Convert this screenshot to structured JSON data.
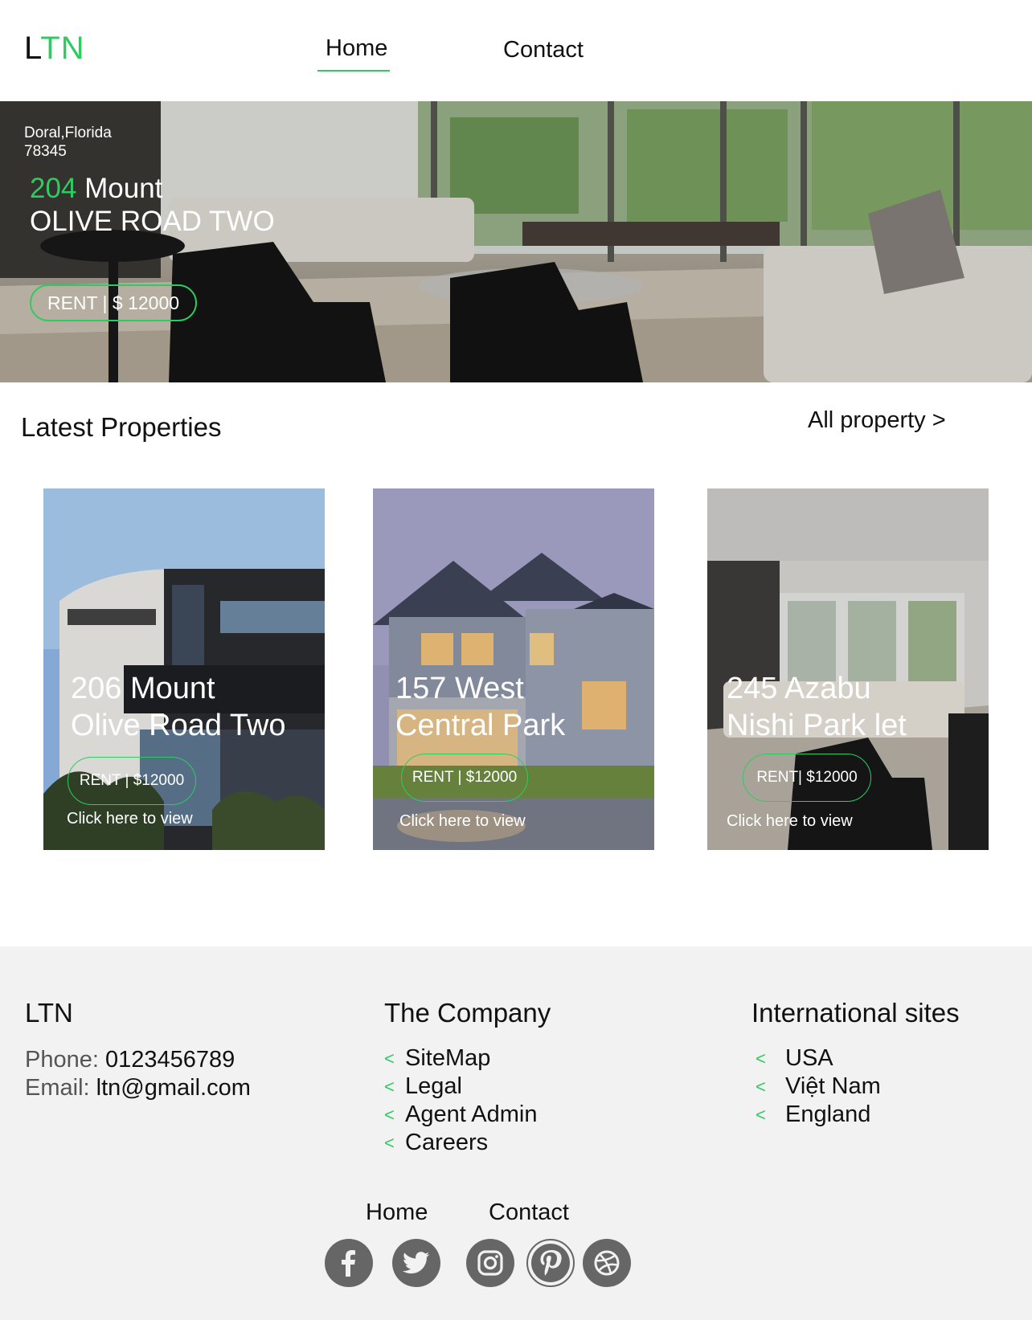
{
  "header": {
    "logo_prefix": "L",
    "logo_accent": "TN",
    "nav": {
      "home": "Home",
      "contact": "Contact"
    }
  },
  "hero": {
    "location_line1": "Doral,Florida",
    "location_line2": "78345",
    "title_number": "204",
    "title_rest": " Mount",
    "title_line2": "OLIVE ROAD TWO",
    "price_label": "RENT | $ 12000"
  },
  "latest": {
    "title": "Latest Properties",
    "all_link": "All property >",
    "cards": [
      {
        "line1": "206 Mount",
        "line2": "Olive Road Two",
        "price": "RENT | $12000",
        "cta": "Click here to view"
      },
      {
        "line1": "157 West",
        "line2": "Central Park",
        "price": "RENT | $12000",
        "cta": "Click here to view"
      },
      {
        "line1": "245 Azabu",
        "line2": "Nishi Park let",
        "price": "RENT| $12000",
        "cta": "Click here to view"
      }
    ]
  },
  "footer": {
    "brand": "LTN",
    "phone_label": "Phone:",
    "phone_value": "0123456789",
    "email_label": "Email:",
    "email_value": "ltn@gmail.com",
    "company": {
      "title": "The Company",
      "links": [
        "SiteMap",
        "Legal",
        "Agent Admin",
        "Careers"
      ]
    },
    "international": {
      "title": "International sites",
      "links": [
        "USA",
        "Việt Nam",
        "England"
      ]
    },
    "chevron": "<",
    "nav": {
      "home": "Home",
      "contact": "Contact"
    },
    "social": [
      "facebook-icon",
      "twitter-icon",
      "instagram-icon",
      "pinterest-icon",
      "dribbble-icon"
    ]
  },
  "colors": {
    "accent": "#2ecc60",
    "footer_bg": "#f2f2f2",
    "social_icon": "#666666"
  }
}
